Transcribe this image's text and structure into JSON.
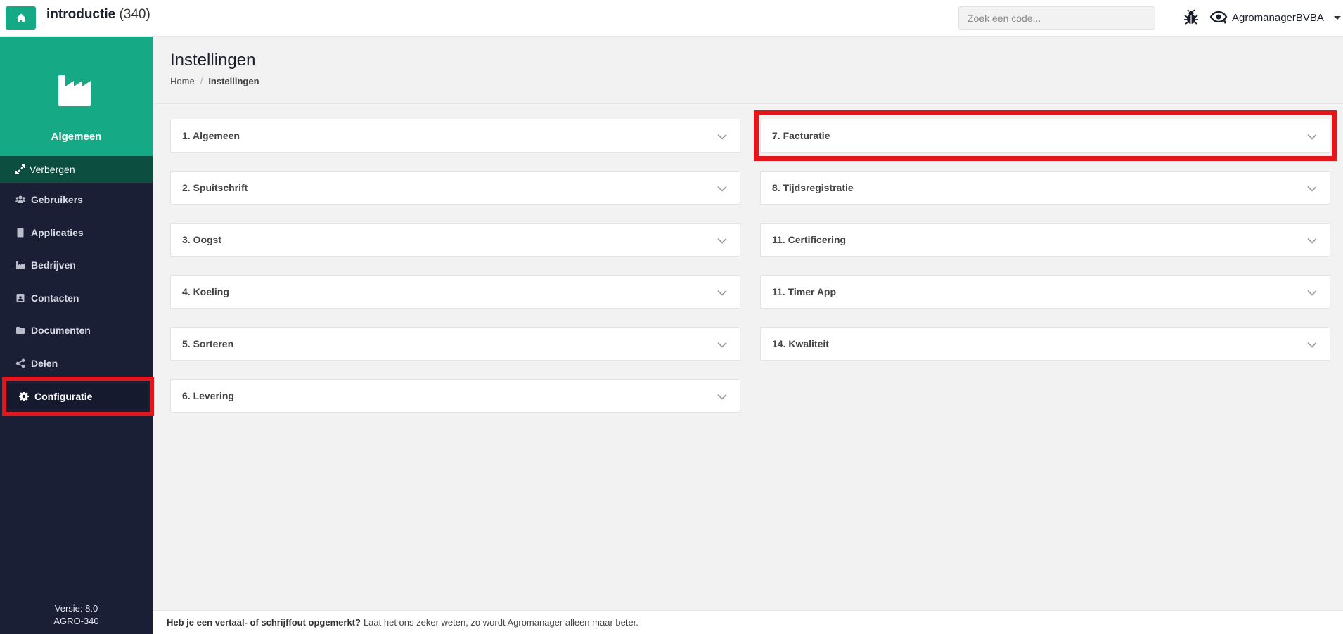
{
  "header": {
    "title": "introductie",
    "count": "(340)",
    "search_placeholder": "Zoek een code...",
    "user_name": "AgromanagerBVBA"
  },
  "sidebar": {
    "section_title": "Algemeen",
    "hide_label": "Verbergen",
    "items": [
      {
        "label": "Gebruikers",
        "icon": "users-icon"
      },
      {
        "label": "Applicaties",
        "icon": "tablet-icon"
      },
      {
        "label": "Bedrijven",
        "icon": "factory-icon"
      },
      {
        "label": "Contacten",
        "icon": "contact-card-icon"
      },
      {
        "label": "Documenten",
        "icon": "folder-icon"
      },
      {
        "label": "Delen",
        "icon": "share-icon"
      },
      {
        "label": "Configuratie",
        "icon": "gear-icon",
        "active": true
      }
    ],
    "version": "Versie: 8.0",
    "build": "AGRO-340"
  },
  "main": {
    "title": "Instellingen",
    "breadcrumb": [
      "Home",
      "Instellingen"
    ],
    "left_panels": [
      "1. Algemeen",
      "2. Spuitschrift",
      "3. Oogst",
      "4. Koeling",
      "5. Sorteren",
      "6. Levering"
    ],
    "right_panels": [
      "7. Facturatie",
      "8. Tijdsregistratie",
      "11. Certificering",
      "11. Timer App",
      "14. Kwaliteit"
    ]
  },
  "footer": {
    "bold": "Heb je een vertaal- of schrijffout opgemerkt?",
    "text": "Laat het ons zeker weten, zo wordt Agromanager alleen maar beter."
  },
  "colors": {
    "accent": "#16a985",
    "sidebar_bg": "#1a1f36",
    "highlight": "#e3161c"
  }
}
